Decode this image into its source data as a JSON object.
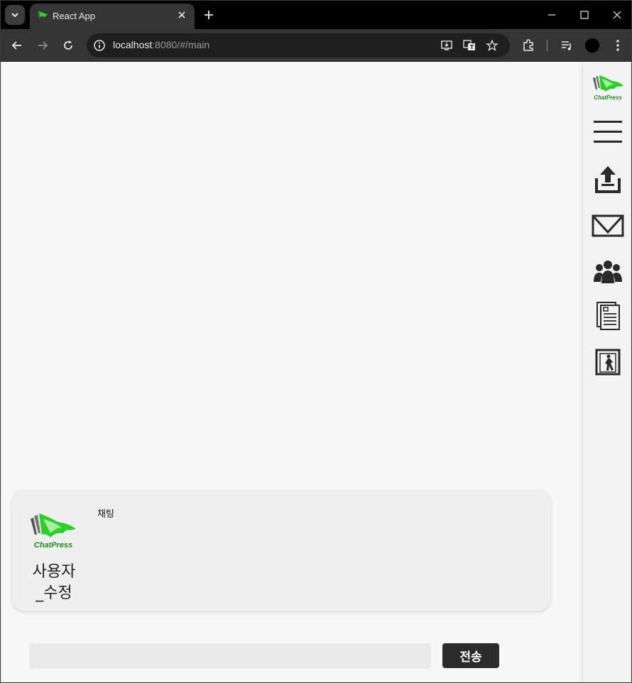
{
  "browser": {
    "tab_title": "React App",
    "url_host": "localhost",
    "url_path": ":8080/#/main"
  },
  "icons": {
    "favicon": "chatpress-flag-icon",
    "tab_search": "chevron-down-icon",
    "back": "arrow-left-icon",
    "forward": "arrow-right-icon",
    "reload": "reload-icon",
    "site_info": "info-icon",
    "install": "install-app-icon",
    "translate": "translate-icon",
    "bookmark": "star-icon",
    "extensions": "puzzle-icon",
    "media": "media-control-icon",
    "profile": "avatar",
    "menu": "kebab-menu-icon"
  },
  "sidebar": {
    "logo_text": "ChatPress",
    "items": [
      {
        "icon": "hamburger-menu-icon"
      },
      {
        "icon": "upload-icon"
      },
      {
        "icon": "mail-icon"
      },
      {
        "icon": "people-icon"
      },
      {
        "icon": "document-icon"
      },
      {
        "icon": "exit-door-icon"
      }
    ]
  },
  "chat": {
    "title": "채팅",
    "logo_text": "ChatPress",
    "user_name": "사용자_수정"
  },
  "composer": {
    "input_value": "",
    "send_label": "전송"
  },
  "colors": {
    "brand_green": "#2fcf2a",
    "brand_dark_green": "#1d8f1f",
    "sidebar_icon": "#2a2a2a",
    "send_bg": "#2b2b2b"
  }
}
